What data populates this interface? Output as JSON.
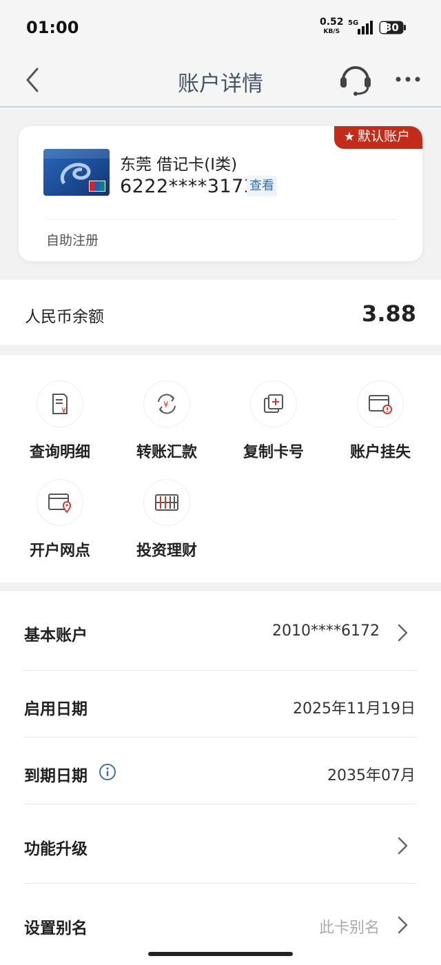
{
  "status_bar": {
    "time": "01:00",
    "network_speed": "0.52",
    "network_unit": "KB/S",
    "network_type": "5G",
    "battery": "30"
  },
  "nav": {
    "title": "账户详情",
    "back_icon": "chevron-left-icon",
    "service_icon": "headset-icon",
    "more_icon": "more-dots-icon"
  },
  "card": {
    "default_badge": "默认账户",
    "name": "东莞 借记卡(I类)",
    "number": "6222****3173",
    "view_label": "查看",
    "registration": "自助注册"
  },
  "balance": {
    "label": "人民币余额",
    "value": "3.88"
  },
  "functions": [
    {
      "label": "查询明细",
      "icon": "statement-icon"
    },
    {
      "label": "转账汇款",
      "icon": "transfer-icon"
    },
    {
      "label": "复制卡号",
      "icon": "copy-icon"
    },
    {
      "label": "账户挂失",
      "icon": "report-loss-icon"
    },
    {
      "label": "开户网点",
      "icon": "branch-location-icon"
    },
    {
      "label": "投资理财",
      "icon": "investment-icon"
    }
  ],
  "details": {
    "basic_account": {
      "label": "基本账户",
      "value": "2010****6172"
    },
    "activation_date": {
      "label": "启用日期",
      "value": "2025年11月19日"
    },
    "expiry_date": {
      "label": "到期日期",
      "value": "2035年07月"
    },
    "upgrade": {
      "label": "功能升级"
    },
    "alias": {
      "label": "设置别名",
      "placeholder": "此卡别名"
    }
  },
  "colors": {
    "accent_red": "#c42b19",
    "link_blue": "#3a6fb0",
    "title_gray": "#4a5563"
  }
}
